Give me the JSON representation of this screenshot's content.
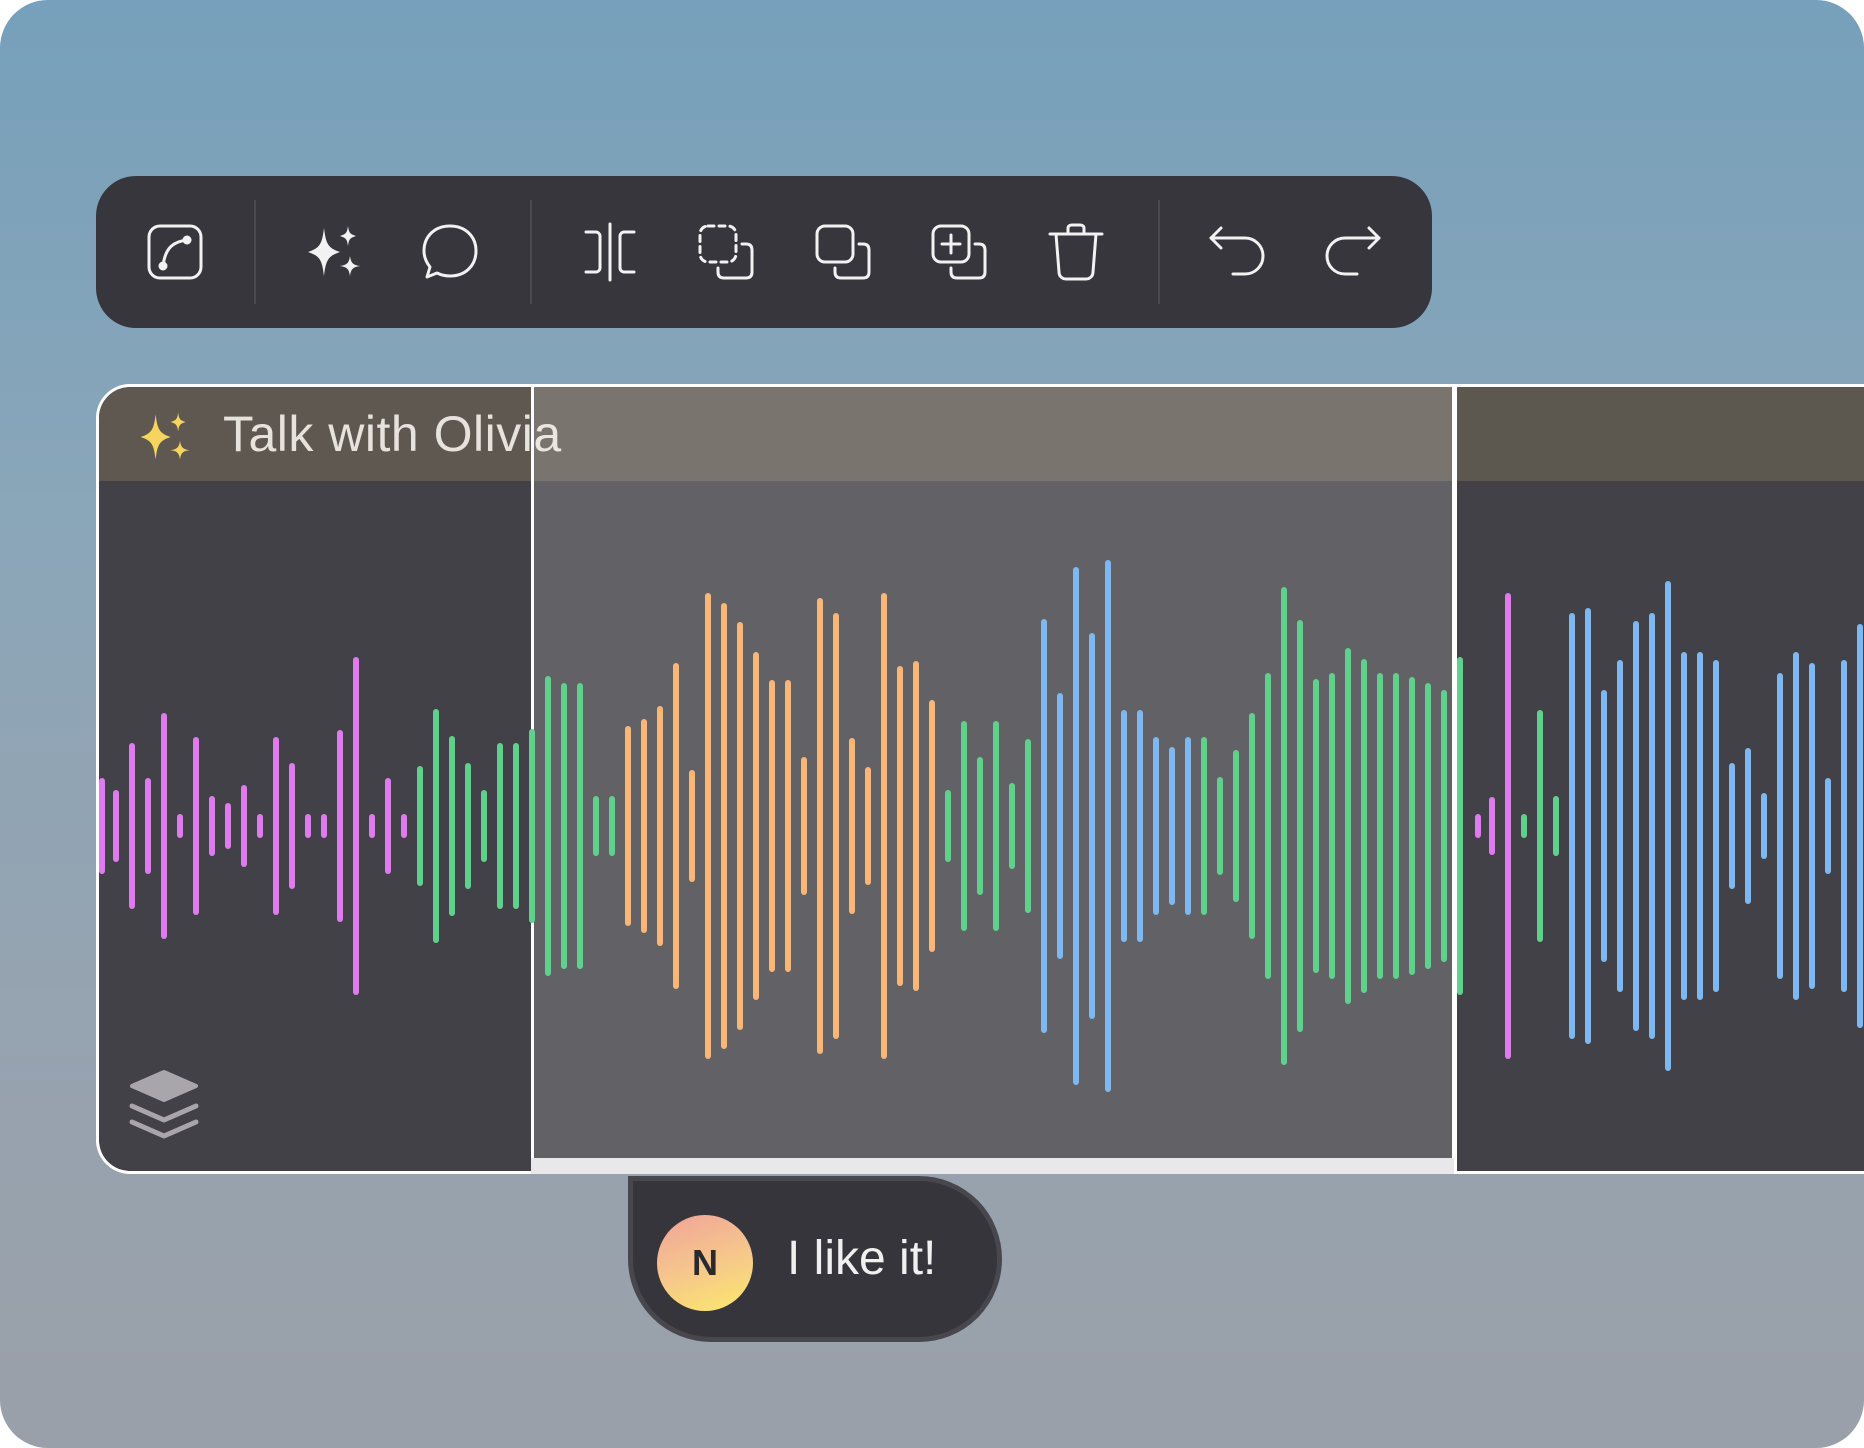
{
  "toolbar": {
    "tools": [
      {
        "icon": "curve-path-icon"
      },
      {
        "icon": "ai-sparkle-icon"
      },
      {
        "icon": "comment-icon"
      },
      {
        "icon": "split-icon"
      },
      {
        "icon": "select-region-icon"
      },
      {
        "icon": "duplicate-icon"
      },
      {
        "icon": "add-copy-icon"
      },
      {
        "icon": "trash-icon"
      },
      {
        "icon": "undo-icon"
      },
      {
        "icon": "redo-icon"
      }
    ]
  },
  "clip": {
    "title": "Talk with Olivia",
    "title_icon": "ai-sparkle-icon",
    "layers_icon": "layers-icon"
  },
  "comment": {
    "avatar_initial": "N",
    "text": "I like it!"
  },
  "colors": {
    "pink": "#e07bef",
    "green": "#5fd18d",
    "orange": "#f8b778",
    "blue": "#7db8f0"
  }
}
